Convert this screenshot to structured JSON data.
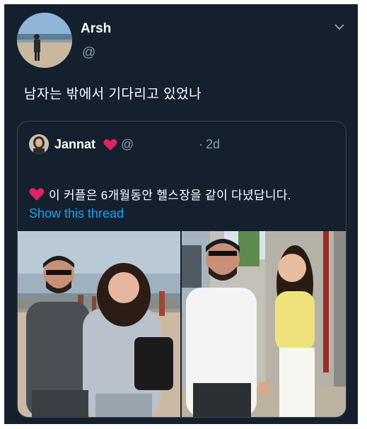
{
  "author": {
    "name": "Arsh",
    "handle": "@"
  },
  "tweet": {
    "text": "남자는 밖에서 기다리고 있었나"
  },
  "quoted": {
    "name": "Jannat",
    "handle": "@",
    "dot": "·",
    "time": "2d",
    "text": "이 커플은 6개월동안 헬스장을 같이 다녔답니다.",
    "show_thread": "Show this thread"
  },
  "icons": {
    "menu": "chevron-down-icon",
    "heart": "red-heart-emoji"
  },
  "colors": {
    "background": "#14202d",
    "border": "#38444d",
    "secondary_text": "#8899a6",
    "link": "#1da1f2",
    "heart": "#e0245e"
  }
}
